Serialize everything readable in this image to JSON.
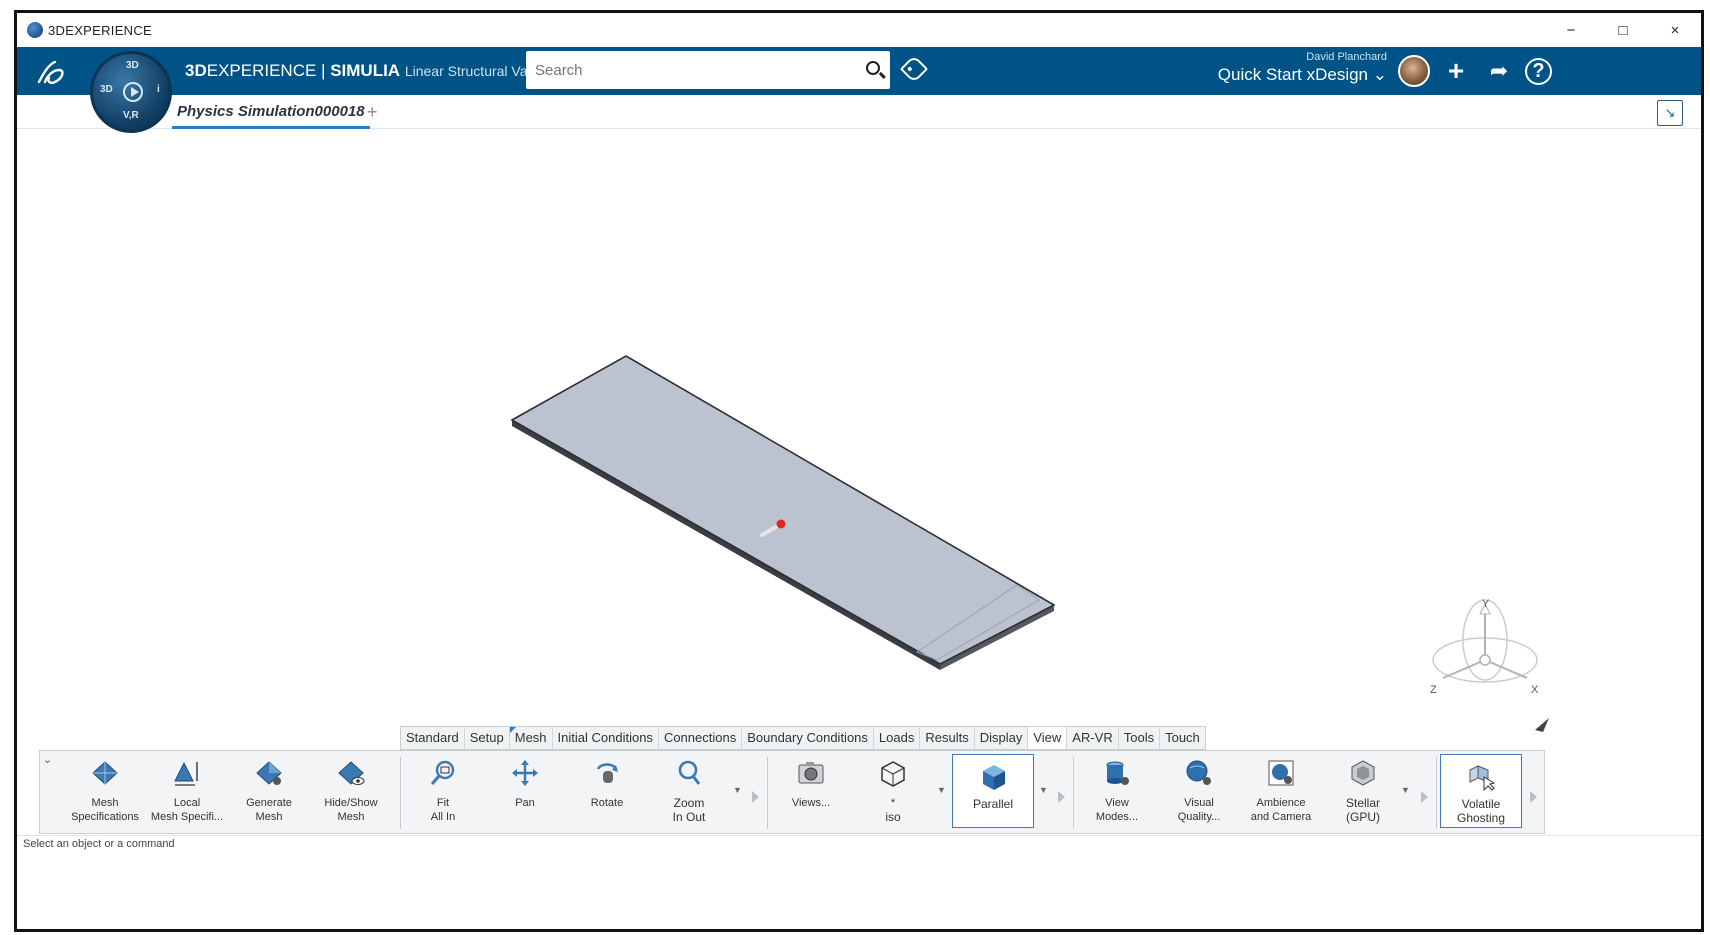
{
  "os_window": {
    "title": "3DEXPERIENCE",
    "minimize": "−",
    "maximize": "□",
    "close": "×"
  },
  "header": {
    "brand_bold_1": "3D",
    "brand_light_1": "EXPERIENCE",
    "brand_sep": " | ",
    "brand_bold_2": "SIMULIA",
    "brand_app": "Linear Structural Va...",
    "search_placeholder": "Search",
    "user_name": "David Planchard",
    "collab_space": "Quick Start xDesign",
    "add_symbol": "+",
    "share_symbol": "➦",
    "help_symbol": "?"
  },
  "compass": {
    "top": "3D",
    "left": "3D",
    "right": "i",
    "bottom": "V,R"
  },
  "doc_tabs": {
    "active": "Physics Simulation000018",
    "add": "+"
  },
  "action_tabs": [
    {
      "label": "Standard"
    },
    {
      "label": "Setup"
    },
    {
      "label": "Mesh"
    },
    {
      "label": "Initial Conditions"
    },
    {
      "label": "Connections"
    },
    {
      "label": "Boundary Conditions"
    },
    {
      "label": "Loads"
    },
    {
      "label": "Results"
    },
    {
      "label": "Display"
    },
    {
      "label": "View"
    },
    {
      "label": "AR-VR"
    },
    {
      "label": "Tools"
    },
    {
      "label": "Touch"
    }
  ],
  "tools": {
    "mesh_specs": {
      "l1": "Mesh",
      "l2": "Specifications"
    },
    "local_mesh": {
      "l1": "Local",
      "l2": "Mesh Specifi..."
    },
    "generate_mesh": {
      "l1": "Generate",
      "l2": "Mesh"
    },
    "hide_show_mesh": {
      "l1": "Hide/Show",
      "l2": "Mesh"
    },
    "fit_all": {
      "l1": "Fit",
      "l2": "All In"
    },
    "pan": {
      "l1": "Pan",
      "l2": ""
    },
    "rotate": {
      "l1": "Rotate",
      "l2": ""
    },
    "zoom": {
      "l1": "Zoom",
      "l2": "In Out"
    },
    "views": {
      "l1": "Views...",
      "l2": ""
    },
    "iso": {
      "l1": "*",
      "l2": "iso"
    },
    "parallel": {
      "l1": "Parallel",
      "l2": ""
    },
    "view_modes": {
      "l1": "View",
      "l2": "Modes..."
    },
    "visual_quality": {
      "l1": "Visual",
      "l2": "Quality..."
    },
    "ambience": {
      "l1": "Ambience",
      "l2": "and Camera"
    },
    "stellar": {
      "l1": "Stellar",
      "l2": "(GPU)"
    },
    "volatile_ghosting": {
      "l1": "Volatile",
      "l2": "Ghosting"
    }
  },
  "triad": {
    "x": "X",
    "y": "Y",
    "z": "Z"
  },
  "status": {
    "text": "Select an object or a command"
  },
  "colors": {
    "header_bg": "#005386",
    "part_face": "#bcc3d0",
    "accent": "#2a7fc4"
  }
}
